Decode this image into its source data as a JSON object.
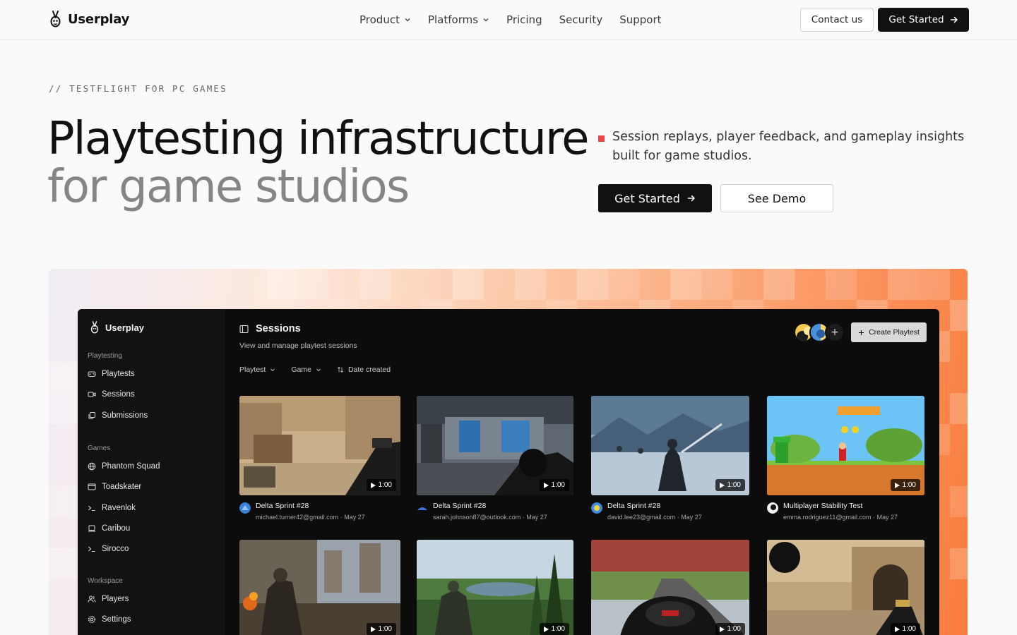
{
  "nav": {
    "brand": "Userplay",
    "links": [
      {
        "label": "Product",
        "has_dropdown": true
      },
      {
        "label": "Platforms",
        "has_dropdown": true
      },
      {
        "label": "Pricing",
        "has_dropdown": false
      },
      {
        "label": "Security",
        "has_dropdown": false
      },
      {
        "label": "Support",
        "has_dropdown": false
      }
    ],
    "contact_label": "Contact us",
    "cta_label": "Get Started"
  },
  "hero": {
    "eyebrow": "// TESTFLIGHT FOR PC GAMES",
    "headline_line1": "Playtesting infrastructure",
    "headline_line2": "for game studios",
    "tagline": "Session replays, player feedback, and gameplay insights built for game studios.",
    "primary_cta": "Get Started",
    "secondary_cta": "See Demo"
  },
  "colors": {
    "accent_square": "#ef4444",
    "gradient_start": "#f1edf6",
    "gradient_end": "#f97c3d",
    "app_bg": "#0c0c0c"
  },
  "app": {
    "brand": "Userplay",
    "sidebar": {
      "sections": [
        {
          "title": "Playtesting",
          "items": [
            {
              "label": "Playtests",
              "icon": "gamepad-icon"
            },
            {
              "label": "Sessions",
              "icon": "video-icon"
            },
            {
              "label": "Submissions",
              "icon": "copy-icon"
            }
          ]
        },
        {
          "title": "Games",
          "items": [
            {
              "label": "Phantom Squad",
              "icon": "globe-icon"
            },
            {
              "label": "Toadskater",
              "icon": "window-icon"
            },
            {
              "label": "Ravenlok",
              "icon": "terminal-icon"
            },
            {
              "label": "Caribou",
              "icon": "laptop-icon"
            },
            {
              "label": "Sirocco",
              "icon": "terminal-icon"
            }
          ]
        },
        {
          "title": "Workspace",
          "items": [
            {
              "label": "Players",
              "icon": "users-icon"
            },
            {
              "label": "Settings",
              "icon": "gear-icon"
            }
          ]
        }
      ]
    },
    "main": {
      "title": "Sessions",
      "subtitle": "View and manage playtest sessions",
      "create_label": "Create Playtest",
      "filters": [
        {
          "label": "Playtest",
          "icon": "chevron-down-icon"
        },
        {
          "label": "Game",
          "icon": "chevron-down-icon"
        },
        {
          "label": "Date created",
          "icon": "sort-icon"
        }
      ],
      "sessions": [
        {
          "title": "Delta Sprint #28",
          "email": "michael.turner42@gmail.com",
          "date": "May 27",
          "duration": "1:00",
          "scene": "desert-shooter"
        },
        {
          "title": "Delta Sprint #28",
          "email": "sarah.johnson87@outlook.com",
          "date": "May 27",
          "duration": "1:00",
          "scene": "station-shooter"
        },
        {
          "title": "Delta Sprint #28",
          "email": "david.lee23@gmail.com",
          "date": "May 27",
          "duration": "1:00",
          "scene": "snow-warrior"
        },
        {
          "title": "Multiplayer Stability Test",
          "email": "emma.rodriguez11@gmail.com",
          "date": "May 27",
          "duration": "1:00",
          "scene": "platformer"
        },
        {
          "title": "",
          "email": "",
          "date": "",
          "duration": "1:00",
          "scene": "castle-knight"
        },
        {
          "title": "",
          "email": "",
          "date": "",
          "duration": "1:00",
          "scene": "forest-soldier"
        },
        {
          "title": "",
          "email": "",
          "date": "",
          "duration": "1:00",
          "scene": "race-car"
        },
        {
          "title": "",
          "email": "",
          "date": "",
          "duration": "1:00",
          "scene": "desert-shooter-2"
        }
      ]
    }
  }
}
